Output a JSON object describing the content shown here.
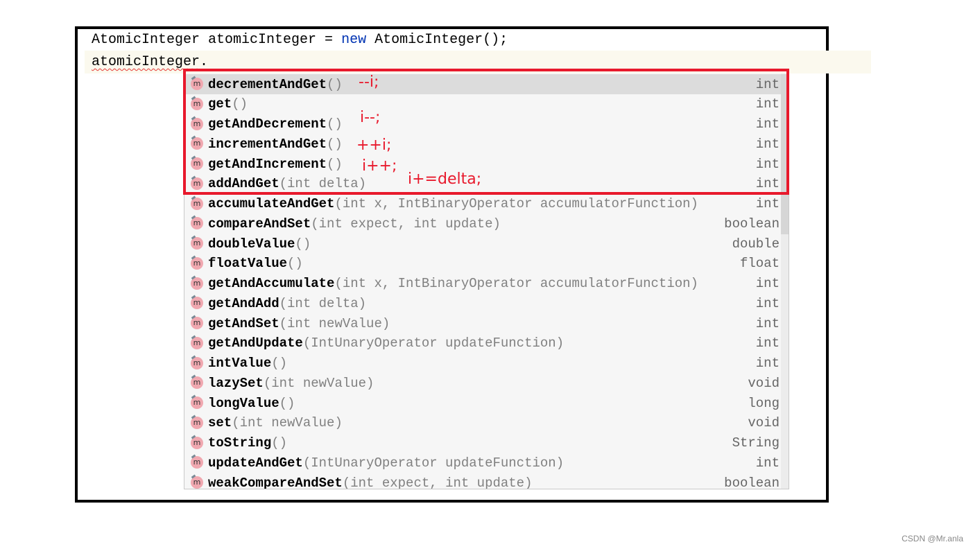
{
  "code": {
    "line1_a": "AtomicInteger atomicInteger = ",
    "line1_kw": "new",
    "line1_b": " AtomicInteger();",
    "line2_var": "atomicInteger",
    "line2_dot": "."
  },
  "items": [
    {
      "name": "decrementAndGet",
      "params": "()",
      "type": "int"
    },
    {
      "name": "get",
      "params": "()",
      "type": "int"
    },
    {
      "name": "getAndDecrement",
      "params": "()",
      "type": "int"
    },
    {
      "name": "incrementAndGet",
      "params": "()",
      "type": "int"
    },
    {
      "name": "getAndIncrement",
      "params": "()",
      "type": "int"
    },
    {
      "name": "addAndGet",
      "params": "(int delta)",
      "type": "int"
    },
    {
      "name": "accumulateAndGet",
      "params": "(int x, IntBinaryOperator accumulatorFunction)",
      "type": "int"
    },
    {
      "name": "compareAndSet",
      "params": "(int expect, int update)",
      "type": "boolean"
    },
    {
      "name": "doubleValue",
      "params": "()",
      "type": "double"
    },
    {
      "name": "floatValue",
      "params": "()",
      "type": "float"
    },
    {
      "name": "getAndAccumulate",
      "params": "(int x, IntBinaryOperator accumulatorFunction)",
      "type": "int"
    },
    {
      "name": "getAndAdd",
      "params": "(int delta)",
      "type": "int"
    },
    {
      "name": "getAndSet",
      "params": "(int newValue)",
      "type": "int"
    },
    {
      "name": "getAndUpdate",
      "params": "(IntUnaryOperator updateFunction)",
      "type": "int"
    },
    {
      "name": "intValue",
      "params": "()",
      "type": "int"
    },
    {
      "name": "lazySet",
      "params": "(int newValue)",
      "type": "void"
    },
    {
      "name": "longValue",
      "params": "()",
      "type": "long"
    },
    {
      "name": "set",
      "params": "(int newValue)",
      "type": "void"
    },
    {
      "name": "toString",
      "params": "()",
      "type": "String"
    },
    {
      "name": "updateAndGet",
      "params": "(IntUnaryOperator updateFunction)",
      "type": "int"
    },
    {
      "name": "weakCompareAndSet",
      "params": "(int expect, int update)",
      "type": "boolean"
    }
  ],
  "icon_letter": "m",
  "notes": [
    "--i;",
    "i--;",
    "++i;",
    "i++;",
    "i+=delta;"
  ],
  "colors": {
    "annotation": "#e8192c",
    "keyword": "#0033b3",
    "selected_row": "#dcdcdc"
  },
  "footer": "CSDN @Mr.anla"
}
